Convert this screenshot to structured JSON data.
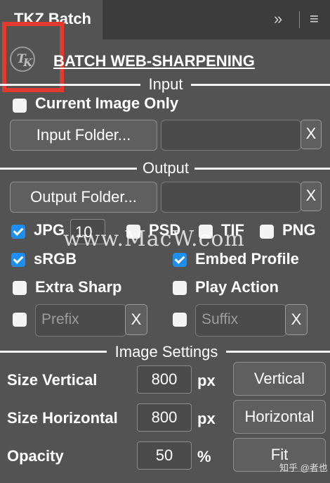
{
  "panel": {
    "tab_title": "TKZ Batch",
    "expand_icon": "double-chevron-right-icon",
    "menu_icon": "hamburger-menu-icon",
    "logo_text": "TK",
    "title": "BATCH WEB-SHARPENING"
  },
  "input_section": {
    "label": "Input",
    "current_image_only": {
      "label": "Current Image Only",
      "checked": false
    },
    "input_folder_button": "Input Folder...",
    "input_folder_path": "",
    "clear_label": "X"
  },
  "output_section": {
    "label": "Output",
    "output_folder_button": "Output Folder...",
    "output_folder_path": "",
    "clear_label": "X",
    "formats": {
      "jpg": {
        "label": "JPG",
        "checked": true,
        "quality": "10"
      },
      "psd": {
        "label": "PSD",
        "checked": false
      },
      "tif": {
        "label": "TIF",
        "checked": false
      },
      "png": {
        "label": "PNG",
        "checked": false
      }
    },
    "srgb": {
      "label": "sRGB",
      "checked": true
    },
    "embed_profile": {
      "label": "Embed Profile",
      "checked": true
    },
    "extra_sharp": {
      "label": "Extra Sharp",
      "checked": false
    },
    "play_action": {
      "label": "Play Action",
      "checked": false
    },
    "prefix": {
      "placeholder": "Prefix",
      "checked": false,
      "clear_label": "X"
    },
    "suffix": {
      "placeholder": "Suffix",
      "checked": false,
      "clear_label": "X"
    }
  },
  "image_settings": {
    "label": "Image Settings",
    "size_vertical": {
      "label": "Size Vertical",
      "value": "800",
      "unit": "px",
      "button": "Vertical"
    },
    "size_horizontal": {
      "label": "Size Horizontal",
      "value": "800",
      "unit": "px",
      "button": "Horizontal"
    },
    "opacity": {
      "label": "Opacity",
      "value": "50",
      "unit": "%",
      "button": "Fit"
    }
  },
  "overlay": {
    "watermark": "www.MacW.com",
    "credit": "知乎 @者也"
  },
  "colors": {
    "panel_bg": "#535353",
    "tab_bar_bg": "#3c3c3c",
    "checkbox_checked": "#1f8ef1",
    "highlight_box": "#e23a2f"
  }
}
